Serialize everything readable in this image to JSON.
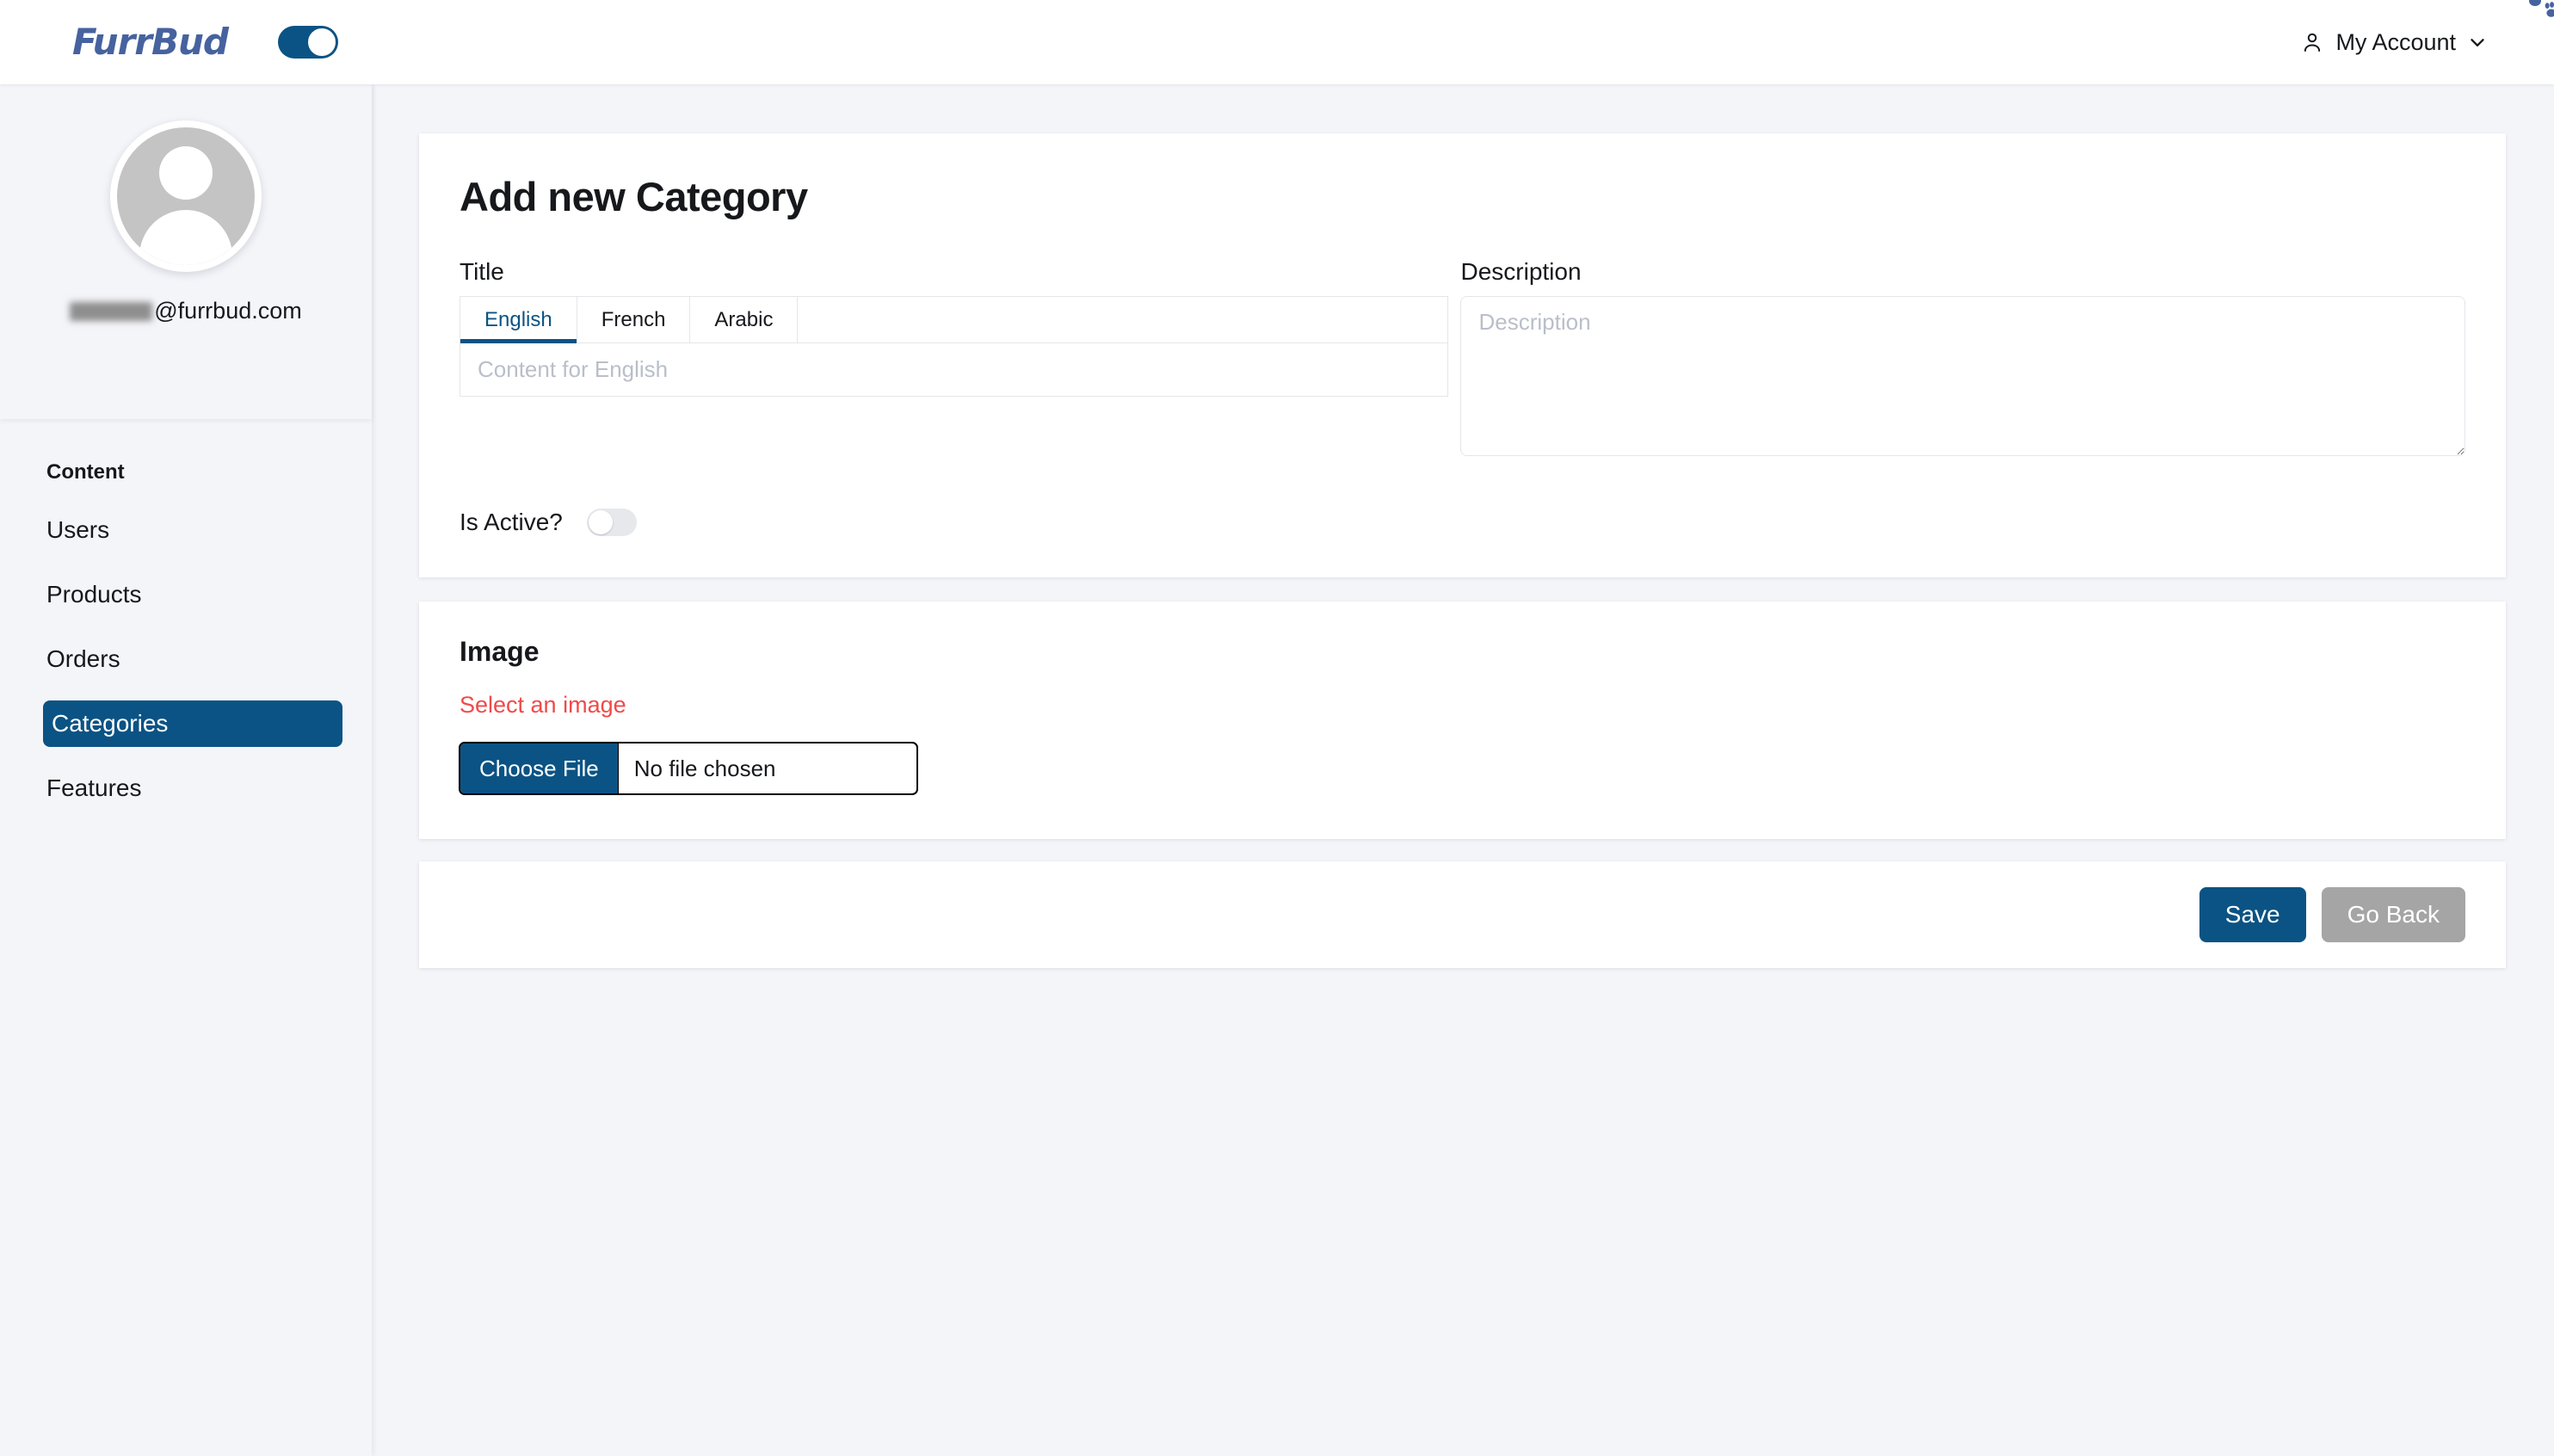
{
  "brand": {
    "logo_text": "FurrBud",
    "header_toggle_state": "on"
  },
  "header": {
    "account_label": "My Account",
    "account_icon": "person-icon",
    "chevron_icon": "chevron-down-icon"
  },
  "sidebar": {
    "avatar_icon": "user-avatar-icon",
    "email": "@furrbud.com",
    "email_redacted_prefix": "",
    "section_title": "Content",
    "items": [
      {
        "label": "Users",
        "active": false
      },
      {
        "label": "Products",
        "active": false
      },
      {
        "label": "Orders",
        "active": false
      },
      {
        "label": "Categories",
        "active": true
      },
      {
        "label": "Features",
        "active": false
      }
    ]
  },
  "main": {
    "page_title": "Add new Category",
    "title_field": {
      "label": "Title",
      "tabs": [
        {
          "label": "English",
          "active": true
        },
        {
          "label": "French",
          "active": false
        },
        {
          "label": "Arabic",
          "active": false
        }
      ],
      "placeholder": "Content for English",
      "value": ""
    },
    "description_field": {
      "label": "Description",
      "placeholder": "Description",
      "value": ""
    },
    "is_active": {
      "label": "Is Active?",
      "state": "off"
    },
    "image_section": {
      "title": "Image",
      "error": "Select an image",
      "choose_file_label": "Choose File",
      "file_name": "No file chosen"
    },
    "actions": {
      "save_label": "Save",
      "go_back_label": "Go Back"
    }
  },
  "colors": {
    "brand_blue": "#0b5384",
    "logo_indigo": "#46629f",
    "error_red": "#f04a4a",
    "secondary_grey": "#a5a5a5",
    "page_bg": "#f4f5f9"
  }
}
